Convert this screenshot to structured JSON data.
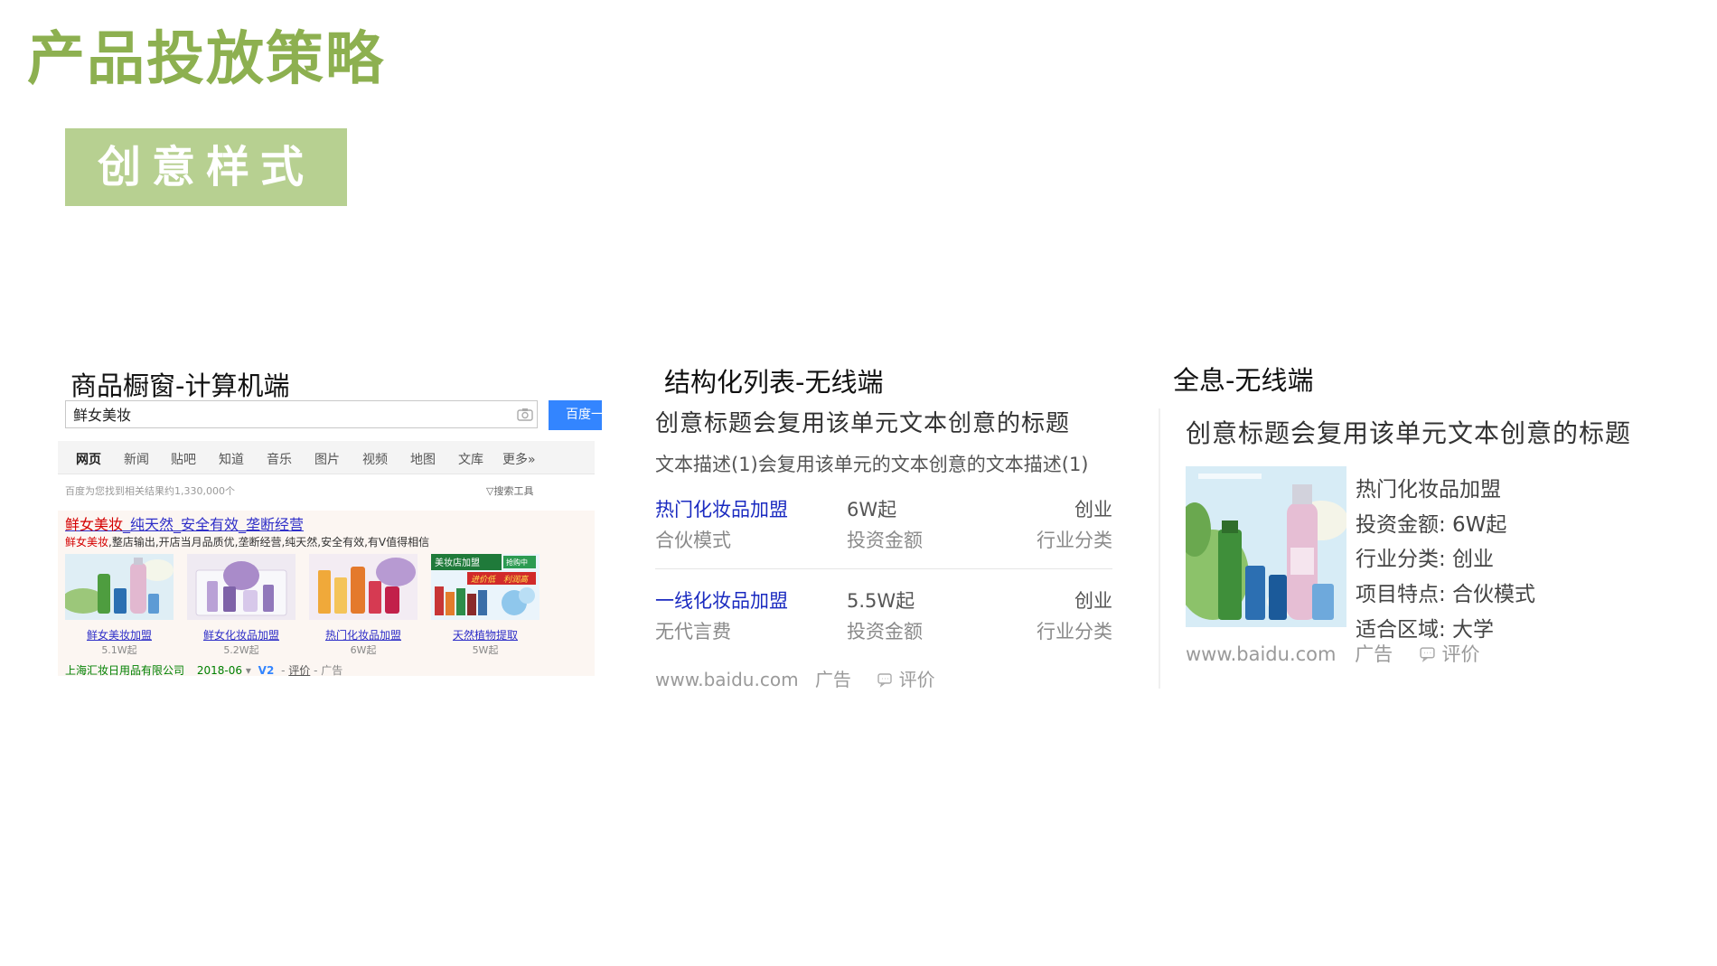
{
  "page": {
    "title": "产品投放策略",
    "badge": "创意样式"
  },
  "panels": {
    "desktop": {
      "label": "商品橱窗-计算机端",
      "search_value": "鲜女美妆",
      "search_button": "百度一",
      "nav": [
        "网页",
        "新闻",
        "贴吧",
        "知道",
        "音乐",
        "图片",
        "视频",
        "地图",
        "文库",
        "更多»"
      ],
      "result_count": "百度为您找到相关结果约1,330,000个",
      "search_tools": "搜索工具",
      "ad_title_highlight": "鲜女美妆",
      "ad_title_rest": "_纯天然_安全有效_垄断经营",
      "ad_desc_highlight": "鲜女美妆",
      "ad_desc_rest": ",整店输出,开店当月品质优,垄断经营,纯天然,安全有效,有V值得相信",
      "products": [
        {
          "name": "鲜女美妆加盟",
          "price": "5.1W起"
        },
        {
          "name": "鲜女化妆品加盟",
          "price": "5.2W起"
        },
        {
          "name": "热门化妆品加盟",
          "price": "6W起"
        },
        {
          "name": "天然植物提取",
          "price": "5W起"
        }
      ],
      "promo_lines": [
        "美妆店加盟",
        "抢购中",
        "进价低",
        "利润高"
      ],
      "footer": {
        "company": "上海汇妆日用品有限公司",
        "date": "2018-06",
        "v_badge": "V2",
        "rating": "评价",
        "ad": "广告"
      }
    },
    "structured": {
      "label": "结构化列表-无线端",
      "ad_title": "创意标题会复用该单元文本创意的标题",
      "ad_desc": "文本描述(1)会复用该单元的文本创意的文本描述(1)",
      "rows": [
        {
          "name": "热门化妆品加盟",
          "sub": "合伙模式",
          "amount": "6W起",
          "amount_label": "投资金额",
          "category": "创业",
          "category_label": "行业分类"
        },
        {
          "name": "一线化妆品加盟",
          "sub": "无代言费",
          "amount": "5.5W起",
          "amount_label": "投资金额",
          "category": "创业",
          "category_label": "行业分类"
        }
      ],
      "footer": {
        "url": "www.baidu.com",
        "ad": "广告",
        "rating": "评价"
      }
    },
    "full_info": {
      "label": "全息-无线端",
      "ad_title": "创意标题会复用该单元文本创意的标题",
      "info_lines": [
        "热门化妆品加盟",
        "投资金额: 6W起",
        "行业分类: 创业",
        "项目特点: 合伙模式",
        "适合区域: 大学"
      ],
      "footer": {
        "url": "www.baidu.com",
        "ad": "广告",
        "rating": "评价"
      }
    }
  },
  "colors": {
    "title_green": "#8db050",
    "badge_green": "#b7d091",
    "baidu_blue": "#3385ff",
    "link_blue": "#1a2ac0",
    "highlight_red": "#d40000"
  }
}
